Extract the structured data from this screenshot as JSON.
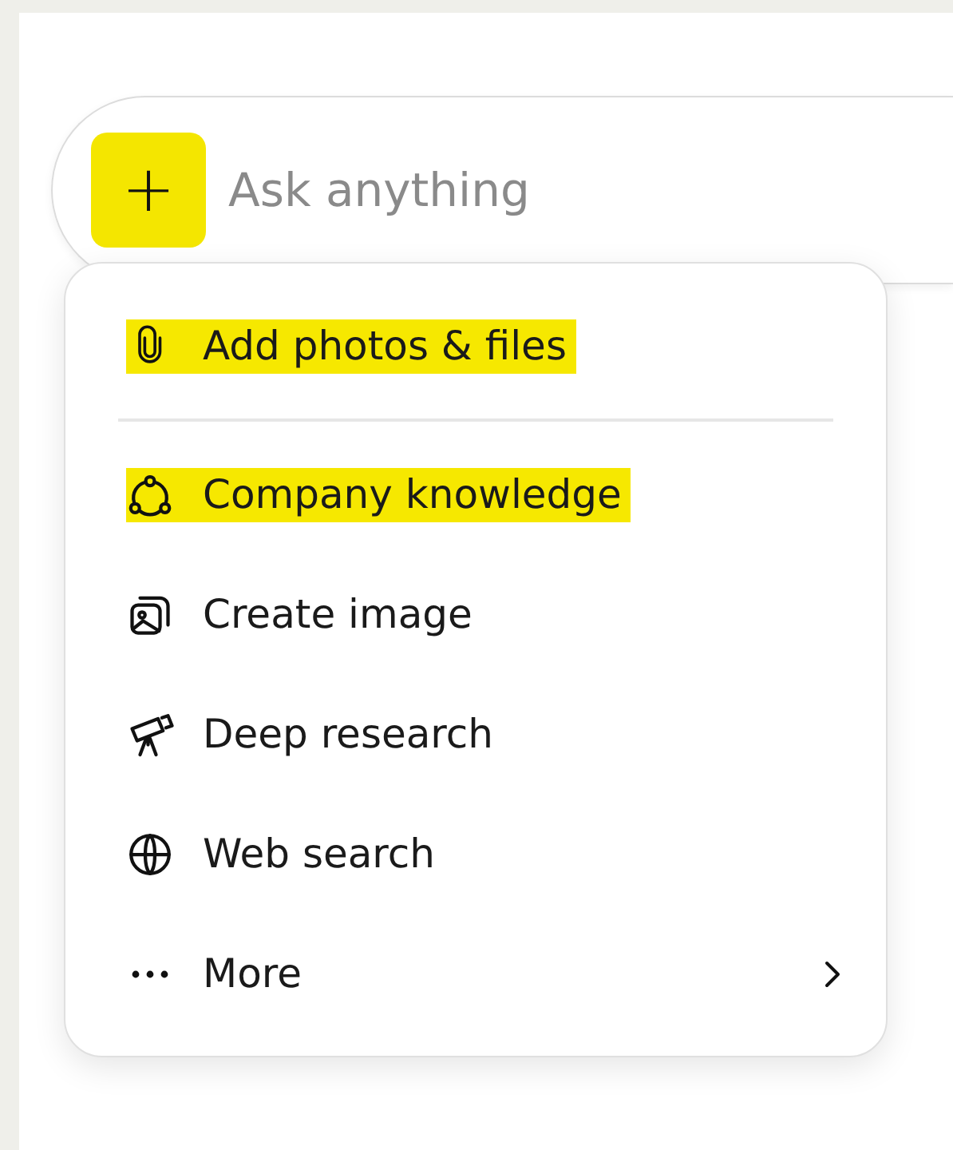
{
  "composer": {
    "add_button": {
      "label": "+",
      "highlighted": true
    },
    "placeholder": "Ask anything"
  },
  "menu": {
    "items": [
      {
        "kind": "action",
        "label": "Add photos & files",
        "highlighted": true
      },
      {
        "kind": "divider"
      },
      {
        "kind": "action",
        "label": "Company knowledge",
        "highlighted": true
      },
      {
        "kind": "action",
        "label": "Create image",
        "highlighted": false
      },
      {
        "kind": "action",
        "label": "Deep research",
        "highlighted": false
      },
      {
        "kind": "action",
        "label": "Web search",
        "highlighted": false
      },
      {
        "kind": "submenu",
        "label": "More",
        "highlighted": false
      }
    ]
  }
}
